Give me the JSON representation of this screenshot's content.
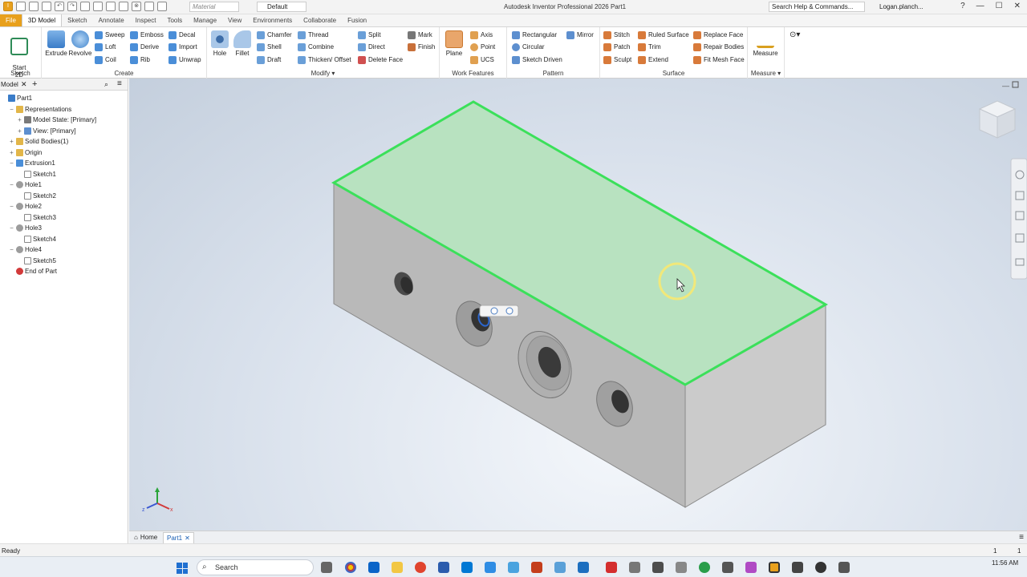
{
  "titlebar": {
    "material_placeholder": "Material",
    "appearance": "Default",
    "title": "Autodesk Inventor Professional 2026    Part1",
    "search": "Search Help & Commands...",
    "user": "Logan.planch...",
    "min": "—",
    "max": "☐",
    "close": "✕"
  },
  "tabs": [
    "File",
    "3D Model",
    "Sketch",
    "Annotate",
    "Inspect",
    "Tools",
    "Manage",
    "View",
    "Environments",
    "Collaborate",
    "Fusion"
  ],
  "ribbon": {
    "sketch": {
      "title": "Sketch",
      "start": "Start\n2D Sketch"
    },
    "create": {
      "title": "Create",
      "extrude": "Extrude",
      "revolve": "Revolve",
      "sweep": "Sweep",
      "emboss": "Emboss",
      "decal": "Decal",
      "loft": "Loft",
      "derive": "Derive",
      "import": "Import",
      "coil": "Coil",
      "rib": "Rib",
      "unwrap": "Unwrap"
    },
    "modify": {
      "title": "Modify ▾",
      "hole": "Hole",
      "fillet": "Fillet",
      "chamfer": "Chamfer",
      "thread": "Thread",
      "shell": "Shell",
      "combine": "Combine",
      "draft": "Draft",
      "thicken": "Thicken/ Offset",
      "split": "Split",
      "direct": "Direct",
      "delete_face": "Delete Face",
      "mark": "Mark",
      "finish": "Finish"
    },
    "work": {
      "title": "Work Features",
      "plane": "Plane",
      "axis": "Axis",
      "point": "Point",
      "ucs": "UCS"
    },
    "pattern": {
      "title": "Pattern",
      "rectangular": "Rectangular",
      "circular": "Circular",
      "sketch_driven": "Sketch Driven",
      "mirror": "Mirror"
    },
    "surface": {
      "title": "Surface",
      "stitch": "Stitch",
      "patch": "Patch",
      "sculpt": "Sculpt",
      "ruled": "Ruled Surface",
      "trim": "Trim",
      "extend": "Extend",
      "replace": "Replace Face",
      "repair": "Repair Bodies",
      "fitmesh": "Fit Mesh Face"
    },
    "measure": {
      "title": "Measure ▾",
      "measure": "Measure"
    }
  },
  "browser": {
    "tab": "Model",
    "tree": [
      {
        "label": "Part1",
        "icon": "part-icon",
        "indent": 0,
        "expand": ""
      },
      {
        "label": "Representations",
        "icon": "folder-icon",
        "indent": 1,
        "expand": "−"
      },
      {
        "label": "Model State: [Primary]",
        "icon": "model-state-icon",
        "indent": 2,
        "expand": "+"
      },
      {
        "label": "View: [Primary]",
        "icon": "view-icon",
        "indent": 2,
        "expand": "+"
      },
      {
        "label": "Solid Bodies(1)",
        "icon": "folder-icon",
        "indent": 1,
        "expand": "+"
      },
      {
        "label": "Origin",
        "icon": "folder-icon",
        "indent": 1,
        "expand": "+"
      },
      {
        "label": "Extrusion1",
        "icon": "extrude-icon",
        "indent": 1,
        "expand": "−"
      },
      {
        "label": "Sketch1",
        "icon": "sketch-icon",
        "indent": 2,
        "expand": ""
      },
      {
        "label": "Hole1",
        "icon": "hole-icon",
        "indent": 1,
        "expand": "−"
      },
      {
        "label": "Sketch2",
        "icon": "sketch-icon",
        "indent": 2,
        "expand": ""
      },
      {
        "label": "Hole2",
        "icon": "hole-icon",
        "indent": 1,
        "expand": "−"
      },
      {
        "label": "Sketch3",
        "icon": "sketch-icon",
        "indent": 2,
        "expand": ""
      },
      {
        "label": "Hole3",
        "icon": "hole-icon",
        "indent": 1,
        "expand": "−"
      },
      {
        "label": "Sketch4",
        "icon": "sketch-icon",
        "indent": 2,
        "expand": ""
      },
      {
        "label": "Hole4",
        "icon": "hole-icon",
        "indent": 1,
        "expand": "−"
      },
      {
        "label": "Sketch5",
        "icon": "sketch-icon",
        "indent": 2,
        "expand": ""
      },
      {
        "label": "End of Part",
        "icon": "end-of-part-icon",
        "indent": 1,
        "expand": ""
      }
    ]
  },
  "doc_tabs": {
    "home": "Home",
    "part": "Part1"
  },
  "status": {
    "text": "Ready",
    "n1": "1",
    "n2": "1"
  },
  "taskbar": {
    "search": "Search",
    "time": "11:56 AM"
  },
  "colors": {
    "accent": "#e8a01c",
    "selection": "#3be05a",
    "selected_face": "#b8e2c0",
    "body": "#bfbfbf"
  }
}
